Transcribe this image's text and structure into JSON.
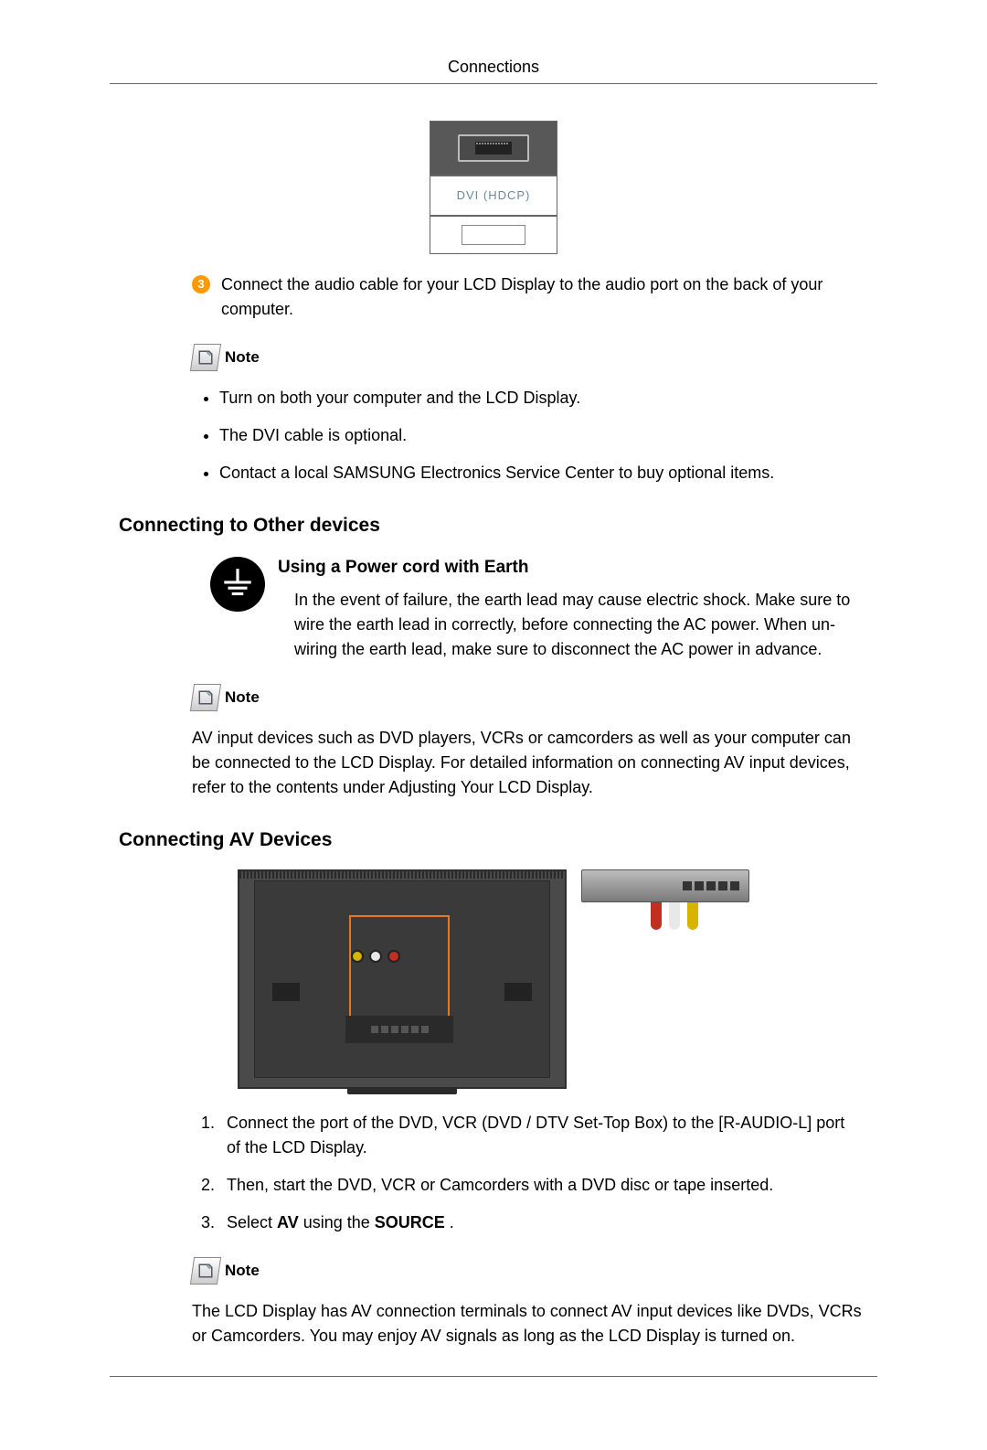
{
  "header": {
    "title": "Connections"
  },
  "dvi_label": "DVI (HDCP)",
  "step3": {
    "num": "3",
    "text": "Connect the audio cable for your LCD Display to the audio port on the back of your computer."
  },
  "note_label": "Note",
  "note1_items": [
    "Turn on both your computer and the LCD Display.",
    "The DVI cable is optional.",
    "Contact a local SAMSUNG Electronics Service Center to buy optional items."
  ],
  "section_other": "Connecting to Other devices",
  "earth": {
    "title": "Using a Power cord with Earth",
    "text": "In the event of failure, the earth lead may cause electric shock. Make sure to wire the earth lead in correctly, before connecting the AC power. When un-wiring the earth lead, make sure to disconnect the AC power in advance."
  },
  "note2_text": "AV input devices such as DVD players, VCRs or camcorders as well as your computer can be connected to the LCD Display. For detailed information on connecting AV input devices, refer to the contents under Adjusting Your LCD Display.",
  "section_av": "Connecting AV Devices",
  "av_steps": {
    "s1": "Connect the port of the DVD, VCR (DVD / DTV Set-Top Box) to the [R-AUDIO-L] port of the LCD Display.",
    "s2": "Then, start the DVD, VCR or Camcorders with a DVD disc or tape inserted.",
    "s3_pre": "Select ",
    "s3_av": "AV",
    "s3_mid": " using the ",
    "s3_src": "SOURCE",
    "s3_post": " ."
  },
  "note3_text": "The LCD Display has AV connection terminals to connect AV input devices like DVDs, VCRs or Camcorders. You may enjoy AV signals as long as the LCD Display is turned on."
}
